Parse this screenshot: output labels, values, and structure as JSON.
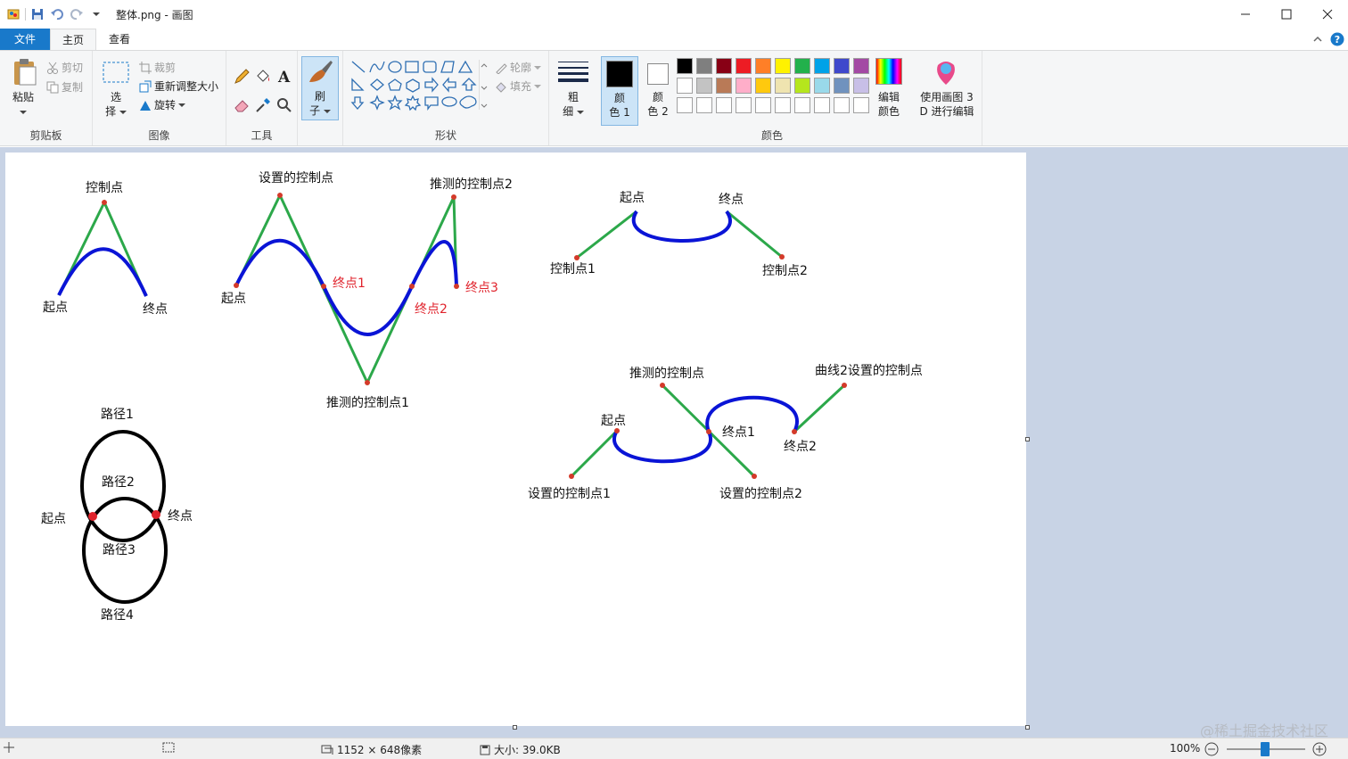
{
  "window": {
    "title": "整体.png - 画图",
    "controls": [
      "minimize-icon",
      "maximize-icon",
      "close-icon"
    ]
  },
  "tabs": [
    {
      "label": "文件"
    },
    {
      "label": "主页"
    },
    {
      "label": "查看"
    }
  ],
  "ribbon": {
    "clipboard": {
      "paste": "粘贴",
      "cut": "剪切",
      "copy": "复制",
      "group": "剪贴板"
    },
    "image": {
      "select_1": "选",
      "select_2": "择",
      "crop": "裁剪",
      "resize": "重新调整大小",
      "rotate": "旋转",
      "group": "图像"
    },
    "tools": {
      "group": "工具"
    },
    "brushes": {
      "label_1": "刷",
      "label_2": "子"
    },
    "shapes": {
      "outline": "轮廓",
      "fill": "填充",
      "group": "形状"
    },
    "size": {
      "label_1": "粗",
      "label_2": "细"
    },
    "color1": {
      "label_1": "颜",
      "label_2": "色 1"
    },
    "color2": {
      "label_1": "颜",
      "label_2": "色 2"
    },
    "colors": {
      "group": "颜色",
      "row1": [
        "#000000",
        "#7f7f7f",
        "#880015",
        "#ed1c24",
        "#ff7f27",
        "#fff200",
        "#22b14c",
        "#00a2e8",
        "#3f48cc",
        "#a349a4"
      ],
      "row2": [
        "#ffffff",
        "#c3c3c3",
        "#b97a57",
        "#ffaec9",
        "#ffc90e",
        "#efe4b0",
        "#b5e61d",
        "#99d9ea",
        "#7092be",
        "#c8bfe7"
      ],
      "row3_count": 10
    },
    "edit_colors": {
      "label_1": "编辑",
      "label_2": "颜色"
    },
    "paint3d": {
      "label_1": "使用画图 3",
      "label_2": "D 进行编辑"
    }
  },
  "canvas_labels": {
    "fig1": {
      "control": "控制点",
      "start": "起点",
      "end": "终点"
    },
    "fig2": {
      "set_control": "设置的控制点",
      "guess_control2": "推测的控制点2",
      "start": "起点",
      "end1": "终点1",
      "end2": "终点2",
      "end3": "终点3",
      "guess_control1": "推测的控制点1"
    },
    "fig3": {
      "start": "起点",
      "end": "终点",
      "control1": "控制点1",
      "control2": "控制点2"
    },
    "fig4": {
      "guess_control": "推测的控制点",
      "curve2_control": "曲线2设置的控制点",
      "start": "起点",
      "end1": "终点1",
      "end2": "终点2",
      "set_control1": "设置的控制点1",
      "set_control2": "设置的控制点2"
    },
    "fig5": {
      "path1": "路径1",
      "path2": "路径2",
      "path3": "路径3",
      "path4": "路径4",
      "start": "起点",
      "end": "终点"
    }
  },
  "status": {
    "dimensions": "1152 × 648像素",
    "size": "大小: 39.0KB",
    "zoom": "100%",
    "zoom_level": 1.0
  },
  "watermark": "@稀土掘金技术社区"
}
